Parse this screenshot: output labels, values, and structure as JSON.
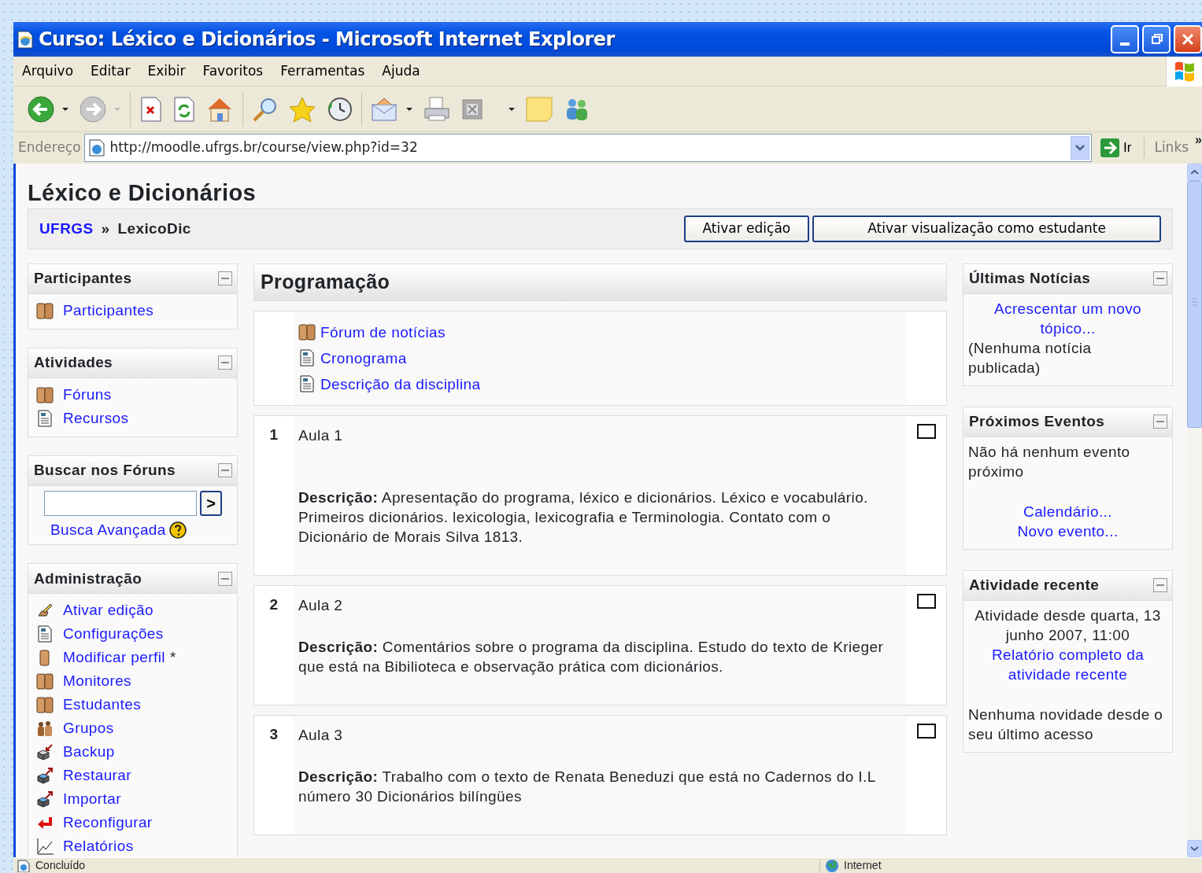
{
  "window": {
    "title": "Curso: Léxico e Dicionários - Microsoft Internet Explorer"
  },
  "menu": [
    "Arquivo",
    "Editar",
    "Exibir",
    "Favoritos",
    "Ferramentas",
    "Ajuda"
  ],
  "address_bar": {
    "label": "Endereço",
    "url": "http://moodle.ufrgs.br/course/view.php?id=32",
    "go_button": "Ir",
    "links": "Links",
    "more": "»"
  },
  "page": {
    "title": "Léxico e Dicionários",
    "breadcrumb": [
      {
        "text": "UFRGS",
        "link": true
      },
      {
        "text": "LexicoDic",
        "link": false
      }
    ],
    "separator": "»",
    "buttons": [
      "Ativar edição",
      "Ativar visualização como estudante"
    ]
  },
  "left_blocks": [
    {
      "title": "Participantes",
      "kind": "list",
      "items": [
        {
          "label": "Participantes"
        }
      ]
    },
    {
      "title": "Atividades",
      "kind": "list",
      "items": [
        {
          "label": "Fóruns"
        },
        {
          "label": "Recursos"
        }
      ]
    },
    {
      "title": "Buscar nos Fóruns",
      "kind": "search",
      "button": ">",
      "link": "Busca Avançada"
    },
    {
      "title": "Administração",
      "kind": "list",
      "items": [
        {
          "label": "Ativar edição"
        },
        {
          "label": "Configurações"
        },
        {
          "label": "Modificar perfil",
          "suffix": "*"
        },
        {
          "label": "Monitores"
        },
        {
          "label": "Estudantes"
        },
        {
          "label": "Grupos"
        },
        {
          "label": "Backup"
        },
        {
          "label": "Restaurar"
        },
        {
          "label": "Importar"
        },
        {
          "label": "Reconfigurar"
        },
        {
          "label": "Relatórios"
        }
      ]
    }
  ],
  "main": {
    "title": "Programação",
    "intro": [
      "Fórum de notícias",
      "Cronograma",
      "Descrição da disciplina"
    ],
    "sections": [
      {
        "number": "1",
        "title": "Aula 1",
        "description": "**Descrição:** Apresentação do programa, léxico e dicionários. Léxico e vocabulário. Primeiros dicionários. lexicologia, lexicografia e Terminologia. Contato com o Dicionário de Morais Silva 1813."
      },
      {
        "number": "2",
        "title": "Aula 2",
        "description": "**Descrição:** Comentários sobre o programa da disciplina. Estudo do texto de Krieger que está na Bibilioteca e observação prática com dicionários."
      },
      {
        "number": "3",
        "title": "Aula 3",
        "description": "**Descrição:** Trabalho com o texto de Renata Beneduzi que está no Cadernos do I.L número 30 Dicionários bilíngües"
      }
    ]
  },
  "right_blocks": [
    {
      "title": "Últimas Notícias",
      "lines": [
        {
          "kind": "link",
          "text": "Acrescentar um novo tópico..."
        },
        {
          "kind": "text",
          "text": "(Nenhuma notícia publicada)"
        }
      ]
    },
    {
      "title": "Próximos Eventos",
      "lines": [
        {
          "kind": "text",
          "text": "Não há nenhum evento próximo"
        },
        {
          "kind": "gap"
        },
        {
          "kind": "link",
          "text": "Calendário..."
        },
        {
          "kind": "link",
          "text": "Novo evento..."
        }
      ]
    },
    {
      "title": "Atividade recente",
      "lines": [
        {
          "kind": "info",
          "text": "Atividade desde quarta, 13 junho 2007, 11:00"
        },
        {
          "kind": "link",
          "text": "Relatório completo da atividade recente"
        },
        {
          "kind": "gap"
        },
        {
          "kind": "text",
          "text": "Nenhuma novidade desde o seu último acesso"
        }
      ]
    }
  ],
  "status_bar": {
    "status": "Concluído",
    "zone": "Internet"
  }
}
